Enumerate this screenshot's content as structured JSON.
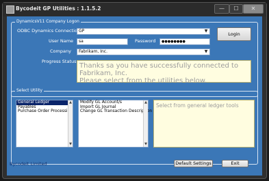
{
  "window": {
    "title": "Bycodeit GP Utilities : 1.1.5.2",
    "min_glyph": "—",
    "max_glyph": "☐",
    "close_glyph": "✕"
  },
  "logon": {
    "legend": "DynamicsV11 Company Logon",
    "odbc_label": "ODBC Dynamics Connection",
    "odbc_value": "GP",
    "user_label": "User Name",
    "user_value": "sa",
    "password_label": "Password",
    "password_value": "●●●●●●●●",
    "company_label": "Company",
    "company_value": "Fabrikam, Inc.",
    "progress_label": "Progress Status",
    "status_text": "Thanks sa you have successfully connected to Fabrikam, Inc.\nPlease select from the utilities below.",
    "login_button": "Login"
  },
  "utility": {
    "legend": "Select Utility",
    "categories": [
      "General Ledger",
      "Payables",
      "Purchase Order Processing"
    ],
    "tools": [
      "Modify GL Account/s",
      "Import GL Journal",
      "Change GL Transaction Description"
    ],
    "tools_description": "Select from general ledger tools"
  },
  "footer": {
    "link": "Bycodeit Limited",
    "default_settings_button": "Default Settings",
    "exit_button": "Exit"
  },
  "colors": {
    "client_bg": "#3b77b7",
    "status_bg": "#fffde0",
    "selection": "#0a246a"
  }
}
